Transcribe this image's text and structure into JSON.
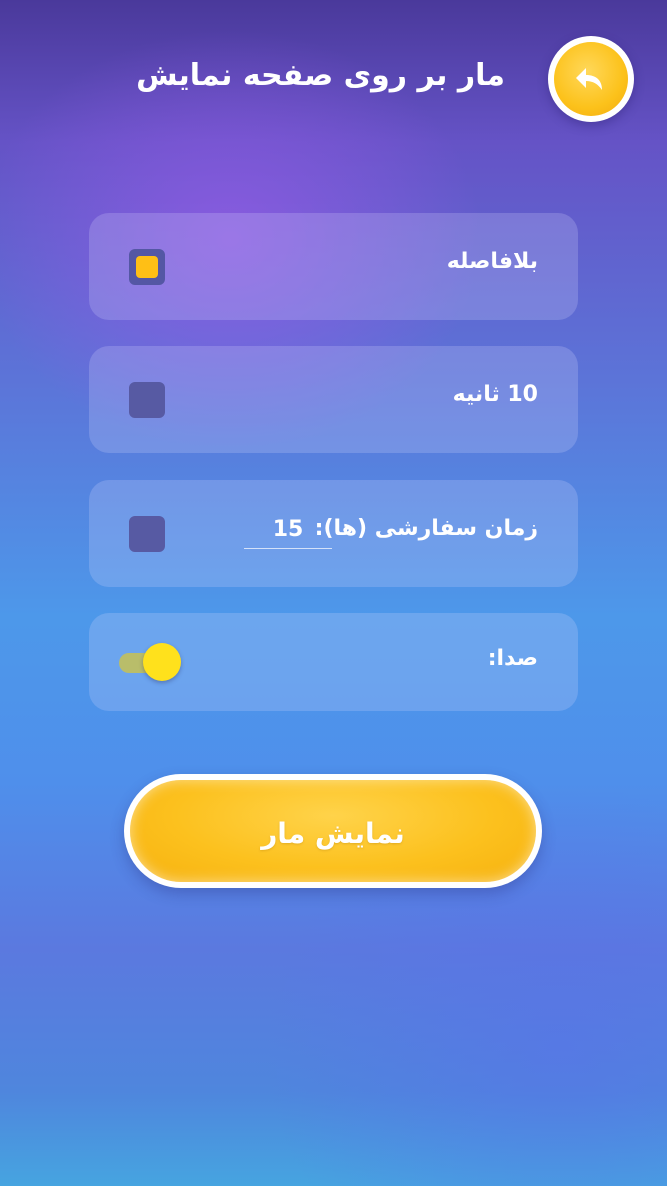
{
  "header": {
    "title": "مار بر روی صفحه نمایش",
    "back_icon": "back-arrow-icon"
  },
  "options": [
    {
      "label": "بلافاصله",
      "checked": true
    },
    {
      "label": "10 ثانیه",
      "checked": false
    },
    {
      "label": "زمان سفارشی (ها):",
      "value": "15",
      "checked": false
    }
  ],
  "sound": {
    "label": "صدا:",
    "enabled": true
  },
  "show_button": {
    "label": "نمایش مار"
  },
  "colors": {
    "accent": "#fcc21b",
    "toggle_knob": "#ffe11c",
    "checkbox_off": "#575aa3"
  }
}
